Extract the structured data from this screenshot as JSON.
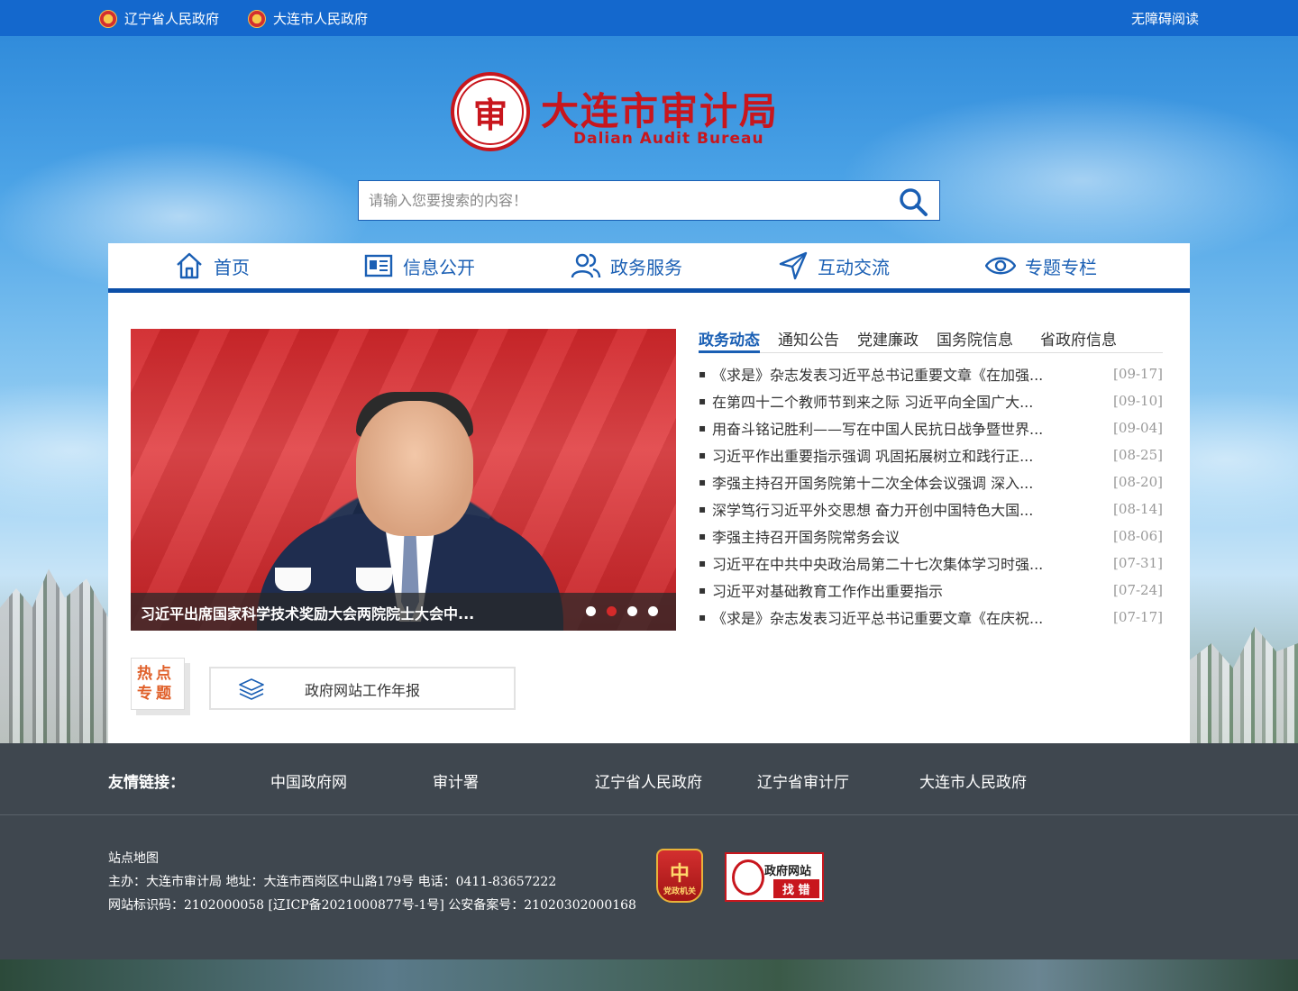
{
  "topbar": {
    "links": [
      "辽宁省人民政府",
      "大连市人民政府"
    ],
    "accessibility": "无障碍阅读"
  },
  "logo": {
    "seal_char": "审",
    "name_cn": "大连市审计局",
    "name_en": "Dalian Audit Bureau"
  },
  "search": {
    "placeholder": "请输入您要搜索的内容！"
  },
  "nav": {
    "items": [
      "首页",
      "信息公开",
      "政务服务",
      "互动交流",
      "专题专栏"
    ]
  },
  "slider": {
    "caption": "习近平出席国家科学技术奖励大会两院院士大会中...",
    "active_dot": 2,
    "dot_count": 4
  },
  "tabs": [
    "政务动态",
    "通知公告",
    "党建廉政",
    "国务院信息",
    "省政府信息"
  ],
  "news": [
    {
      "title": "《求是》杂志发表习近平总书记重要文章《在加强...",
      "date": "[09-17]"
    },
    {
      "title": "在第四十二个教师节到来之际 习近平向全国广大...",
      "date": "[09-10]"
    },
    {
      "title": "用奋斗铭记胜利——写在中国人民抗日战争暨世界...",
      "date": "[09-04]"
    },
    {
      "title": "习近平作出重要指示强调 巩固拓展树立和践行正...",
      "date": "[08-25]"
    },
    {
      "title": "李强主持召开国务院第十二次全体会议强调 深入...",
      "date": "[08-20]"
    },
    {
      "title": "深学笃行习近平外交思想 奋力开创中国特色大国...",
      "date": "[08-14]"
    },
    {
      "title": "李强主持召开国务院常务会议",
      "date": "[08-06]"
    },
    {
      "title": "习近平在中共中央政治局第二十七次集体学习时强...",
      "date": "[07-31]"
    },
    {
      "title": "习近平对基础教育工作作出重要指示",
      "date": "[07-24]"
    },
    {
      "title": "《求是》杂志发表习近平总书记重要文章《在庆祝...",
      "date": "[07-17]"
    }
  ],
  "hot": {
    "line1": "热点",
    "line2": "专题",
    "annual_report": "政府网站工作年报"
  },
  "footer": {
    "friend_label": "友情链接：",
    "friend_links": [
      "中国政府网",
      "审计署",
      "辽宁省人民政府",
      "辽宁省审计厅",
      "大连市人民政府"
    ],
    "sitemap": "站点地图",
    "host": "主办：大连市审计局 地址：大连市西岗区中山路179号 电话：0411-83657222",
    "record": "网站标识码：2102000058 [辽ICP备2021000877号-1号] 公安备案号：21020302000168",
    "badge_party": "党政机关",
    "badge_party_char": "中",
    "badge_error_1": "政府网站",
    "badge_error_2": "找 错"
  },
  "colors": {
    "topbar": "#1468cd",
    "brand_red": "#c8161d",
    "nav_blue": "#1a5fb4",
    "footer": "#3f474f"
  }
}
